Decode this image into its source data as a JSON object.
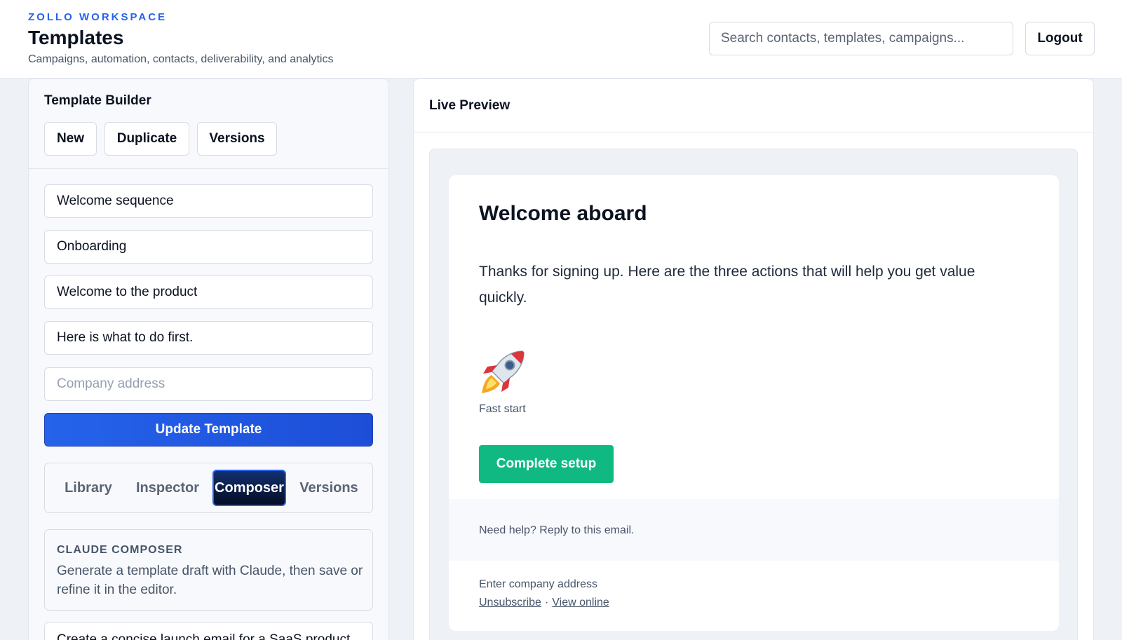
{
  "header": {
    "workspace": "ZOLLO WORKSPACE",
    "title": "Templates",
    "subtitle": "Campaigns, automation, contacts, deliverability, and analytics",
    "search_placeholder": "Search contacts, templates, campaigns...",
    "logout_label": "Logout"
  },
  "builder": {
    "title": "Template Builder",
    "actions": {
      "new": "New",
      "duplicate": "Duplicate",
      "versions": "Versions"
    },
    "fields": {
      "name": "Welcome sequence",
      "category": "Onboarding",
      "subject": "Welcome to the product",
      "preheader": "Here is what to do first.",
      "address_placeholder": "Company address"
    },
    "update_label": "Update Template",
    "tabs": [
      "Library",
      "Inspector",
      "Composer",
      "Versions"
    ],
    "active_tab": "Composer",
    "composer": {
      "label": "CLAUDE COMPOSER",
      "description": "Generate a template draft with Claude, then save or refine it in the editor.",
      "prompt": "Create a concise launch email for a SaaS product"
    }
  },
  "preview": {
    "title": "Live Preview",
    "email": {
      "heading": "Welcome aboard",
      "body": "Thanks for signing up. Here are the three actions that will help you get value quickly.",
      "emoji_icon": "rocket-icon",
      "emoji_caption": "Fast start",
      "cta_label": "Complete setup",
      "help_text": "Need help? Reply to this email.",
      "footer_address": "Enter company address",
      "unsubscribe_label": "Unsubscribe",
      "separator": "·",
      "view_online_label": "View online"
    }
  },
  "colors": {
    "accent": "#2563eb",
    "cta": "#10b981",
    "active_tab": "#050d26"
  }
}
